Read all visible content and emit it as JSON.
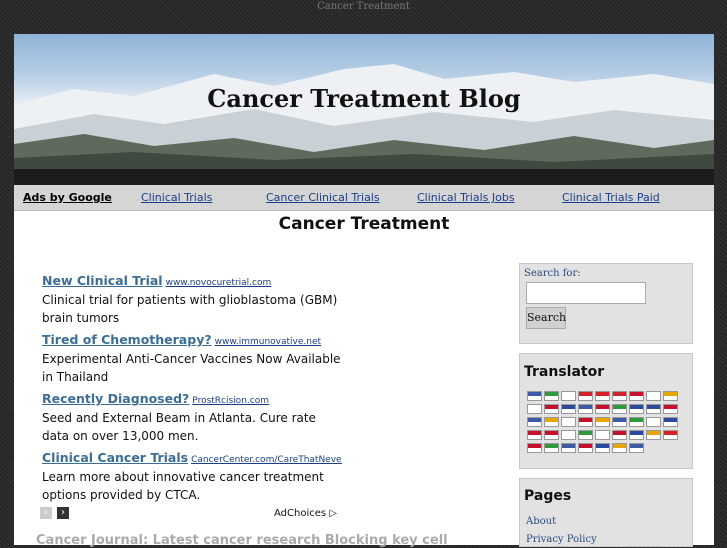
{
  "site": {
    "tagline": "Cancer Treatment",
    "title": "Cancer Treatment Blog"
  },
  "nav": {
    "ads_label": "Ads by Google",
    "links": [
      "Clinical Trials",
      "Cancer Clinical Trials",
      "Clinical Trials Jobs",
      "Clinical Trials Paid"
    ]
  },
  "page_heading": "Cancer Treatment",
  "ads": [
    {
      "title": "New Clinical Trial",
      "url": "www.novocuretrial.com",
      "desc": "Clinical trial for patients with glioblastoma (GBM) brain tumors"
    },
    {
      "title": "Tired of Chemotherapy?",
      "url": "www.immunovative.net",
      "desc": "Experimental Anti-Cancer Vaccines Now Available in Thailand"
    },
    {
      "title": "Recently Diagnosed?",
      "url": "ProstRcision.com",
      "desc": "Seed and External Beam in Atlanta. Cure rate data on over 13,000 men."
    },
    {
      "title": "Clinical Cancer Trials",
      "url": "CancerCenter.com/CareThatNeverQuits",
      "desc": "Learn more about innovative cancer treatment options provided by CTCA."
    }
  ],
  "ad_controls": {
    "prev": "‹",
    "next": "›",
    "adchoices": "AdChoices ▷"
  },
  "post_title": "Cancer Journal: Latest cancer research Blocking key cell",
  "sidebar": {
    "search_label": "Search for:",
    "search_value": "",
    "search_button": "Search",
    "translator_title": "Translator",
    "pages_title": "Pages",
    "pages_links": [
      "About",
      "Privacy Policy"
    ]
  },
  "flag_colors": [
    "#3c5aa6",
    "#2e9a3a",
    "#ffffff",
    "#d2232a",
    "#d2232a",
    "#d2232a",
    "#c8102e",
    "#ffffff",
    "#e8a400",
    "#ffffff",
    "#c8102e",
    "#2a4aa0",
    "#3c5aa6",
    "#c8102e",
    "#2e9a3a",
    "#2a4aa0",
    "#2a4aa0",
    "#c8102e",
    "#3c5aa6",
    "#e8a400",
    "#ffffff",
    "#c8102e",
    "#e8a400",
    "#3c5aa6",
    "#2e9a3a",
    "#ffffff",
    "#2a4aa0",
    "#c8102e",
    "#c8102e",
    "#ffffff",
    "#2e9a3a",
    "#ffffff",
    "#c8102e",
    "#2a4aa0",
    "#e8a400",
    "#d2232a",
    "#c8102e",
    "#2e9a3a",
    "#3c5aa6",
    "#c8102e",
    "#2a4aa0",
    "#e8a400",
    "#3c5aa6"
  ]
}
